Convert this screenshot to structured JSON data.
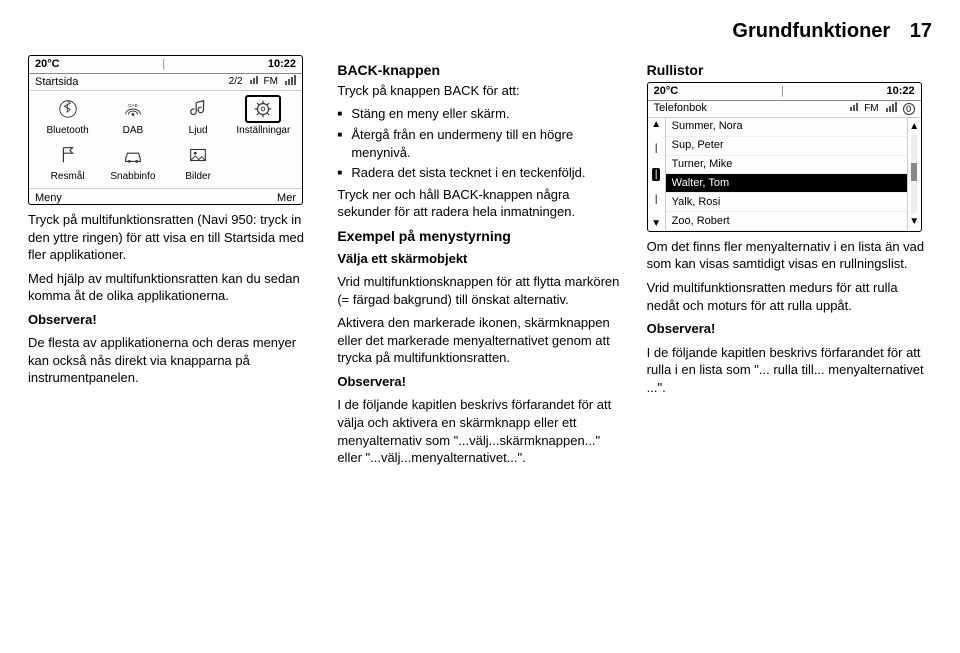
{
  "header": {
    "title": "Grundfunktioner",
    "page": "17"
  },
  "screen1": {
    "statusbar": {
      "temp": "20°C",
      "time": "10:22"
    },
    "titlerow": {
      "label": "Startsida",
      "page": "2/2",
      "fm": "FM"
    },
    "grid": [
      {
        "name": "Bluetooth",
        "icon": "bluetooth"
      },
      {
        "name": "DAB",
        "icon": "dab"
      },
      {
        "name": "Ljud",
        "icon": "note"
      },
      {
        "name": "Inställningar",
        "icon": "gear",
        "selected": true
      },
      {
        "name": "Resmål",
        "icon": "flag"
      },
      {
        "name": "Snabbinfo",
        "icon": "car"
      },
      {
        "name": "Bilder",
        "icon": "image"
      },
      {
        "name": "",
        "icon": ""
      }
    ],
    "footer": {
      "left": "Meny",
      "right": "Mer"
    }
  },
  "screen2": {
    "statusbar": {
      "temp": "20°C",
      "time": "10:22"
    },
    "title": "Telefonbok",
    "fm": "FM",
    "badge": "0",
    "alpha": {
      "top": "▲",
      "bottom": "▼",
      "letters": [
        "|",
        "|"
      ],
      "sel": "|"
    },
    "list": [
      {
        "name": "Summer, Nora"
      },
      {
        "name": "Sup, Peter"
      },
      {
        "name": "Turner, Mike"
      },
      {
        "name": "Walter, Tom",
        "selected": true
      },
      {
        "name": "Yalk, Rosi"
      },
      {
        "name": "Zoo, Robert"
      }
    ]
  },
  "col1": {
    "p1": "Tryck på multifunktionsratten (Navi 950: tryck in den yttre ringen) för att visa en till Startsida med fler applikationer.",
    "p2": "Med hjälp av multifunktionsratten kan du sedan komma åt de olika applikationerna.",
    "obs": "Observera!",
    "p3": "De flesta av applikationerna och deras menyer kan också nås direkt via knapparna på instrumentpanelen."
  },
  "col2": {
    "h1": "BACK-knappen",
    "intro": "Tryck på knappen BACK för att:",
    "bullets": [
      "Stäng en meny eller skärm.",
      "Återgå från en undermeny till en högre menynivå.",
      "Radera det sista tecknet i en teckenföljd."
    ],
    "p1": "Tryck ner och håll BACK-knappen några sekunder för att radera hela inmatningen.",
    "h2": "Exempel på menystyrning",
    "h3": "Välja ett skärmobjekt",
    "p2": "Vrid multifunktionsknappen för att flytta markören (= färgad bakgrund) till önskat alternativ.",
    "p3": "Aktivera den markerade ikonen, skärmknappen eller det markerade menyalternativet genom att trycka på multifunktionsratten.",
    "obs": "Observera!",
    "p4": "I de följande kapitlen beskrivs förfarandet för att välja och aktivera en skärmknapp eller ett menyalternativ som \"...välj...skärmknappen...\" eller \"...välj...menyalternativet...\"."
  },
  "col3": {
    "h1": "Rullistor",
    "p1": "Om det finns fler menyalternativ i en lista än vad som kan visas samtidigt visas en rullningslist.",
    "p2": "Vrid multifunktionsratten medurs för att rulla nedåt och moturs för att rulla uppåt.",
    "obs": "Observera!",
    "p3": "I de följande kapitlen beskrivs förfarandet för att rulla i en lista som \"... rulla till... menyalternativet ...\"."
  }
}
